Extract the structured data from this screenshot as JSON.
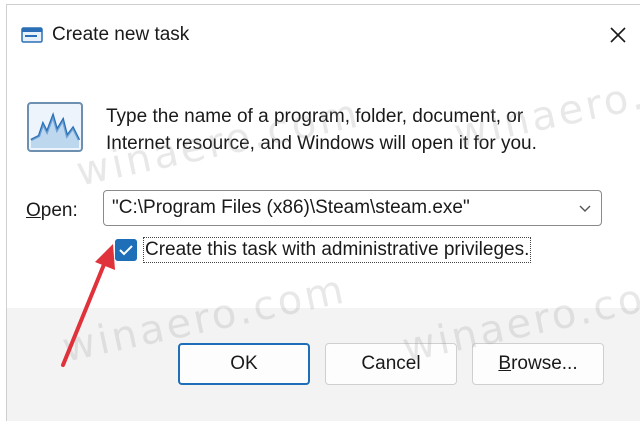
{
  "window": {
    "title": "Create new task",
    "close_icon": "close-icon"
  },
  "content": {
    "description_line1": "Type the name of a program, folder, document, or",
    "description_line2": "Internet resource, and Windows will open it for you.",
    "open_label_prefix": "O",
    "open_label_rest": "pen:",
    "open_value": "\"C:\\Program Files (x86)\\Steam\\steam.exe\"",
    "checkbox_label": "Create this task with administrative privileges.",
    "checkbox_checked": true
  },
  "buttons": {
    "ok": "OK",
    "cancel": "Cancel",
    "browse_prefix": "B",
    "browse_rest": "rowse..."
  },
  "watermark": "winaero.com",
  "colors": {
    "accent": "#1e6fb8",
    "annotation_arrow": "#e0323a",
    "footer_bg": "#f3f3f3"
  }
}
